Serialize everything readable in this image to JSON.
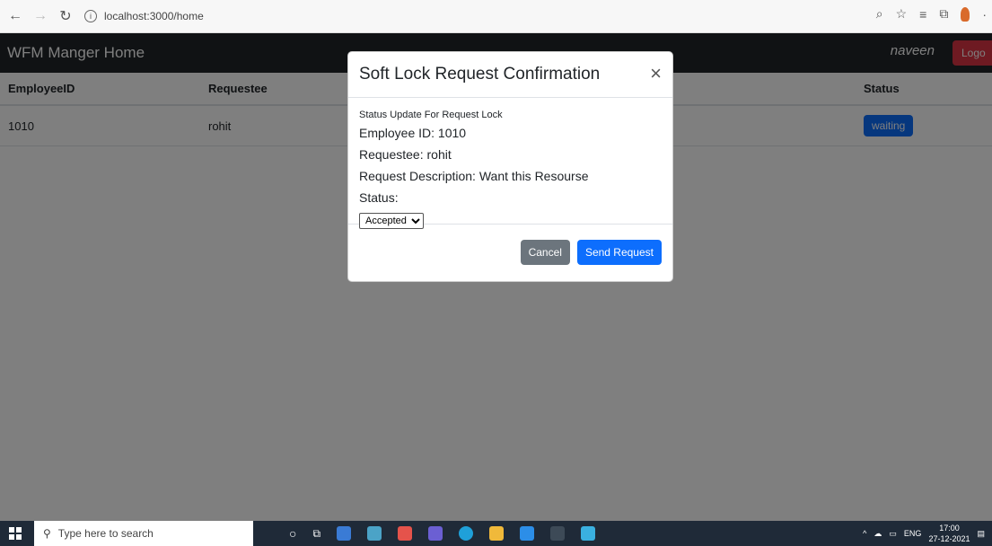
{
  "browser": {
    "url": "localhost:3000/home",
    "icons": [
      "back-arrow-icon",
      "forward-arrow-icon",
      "refresh-icon",
      "info-icon",
      "read-aloud-icon",
      "favorites-add-icon",
      "favorites-icon",
      "collections-icon",
      "profile-icon"
    ]
  },
  "navbar": {
    "brand": "WFM Manger Home",
    "user": "naveen",
    "logout": "Logo"
  },
  "table": {
    "headers": [
      "EmployeeID",
      "Requestee",
      "Status"
    ],
    "rows": [
      {
        "employee_id": "1010",
        "requestee": "rohit",
        "status": "waiting"
      }
    ]
  },
  "modal": {
    "title": "Soft Lock Request Confirmation",
    "close": "×",
    "subtitle": "Status Update For Request Lock",
    "employee_id": "Employee ID: 1010",
    "requestee": "Requestee: rohit",
    "description": "Request Description: Want this Resourse",
    "status_label": "Status:",
    "status_selected": "Accepted",
    "cancel": "Cancel",
    "send": "Send Request"
  },
  "taskbar": {
    "search_placeholder": "Type here to search",
    "lang": "ENG",
    "time": "17:00",
    "date": "27-12-2021"
  },
  "colors": {
    "navbar": "#212529",
    "primary": "#0d6efd",
    "secondary": "#6c757d",
    "danger": "#dc3545"
  }
}
